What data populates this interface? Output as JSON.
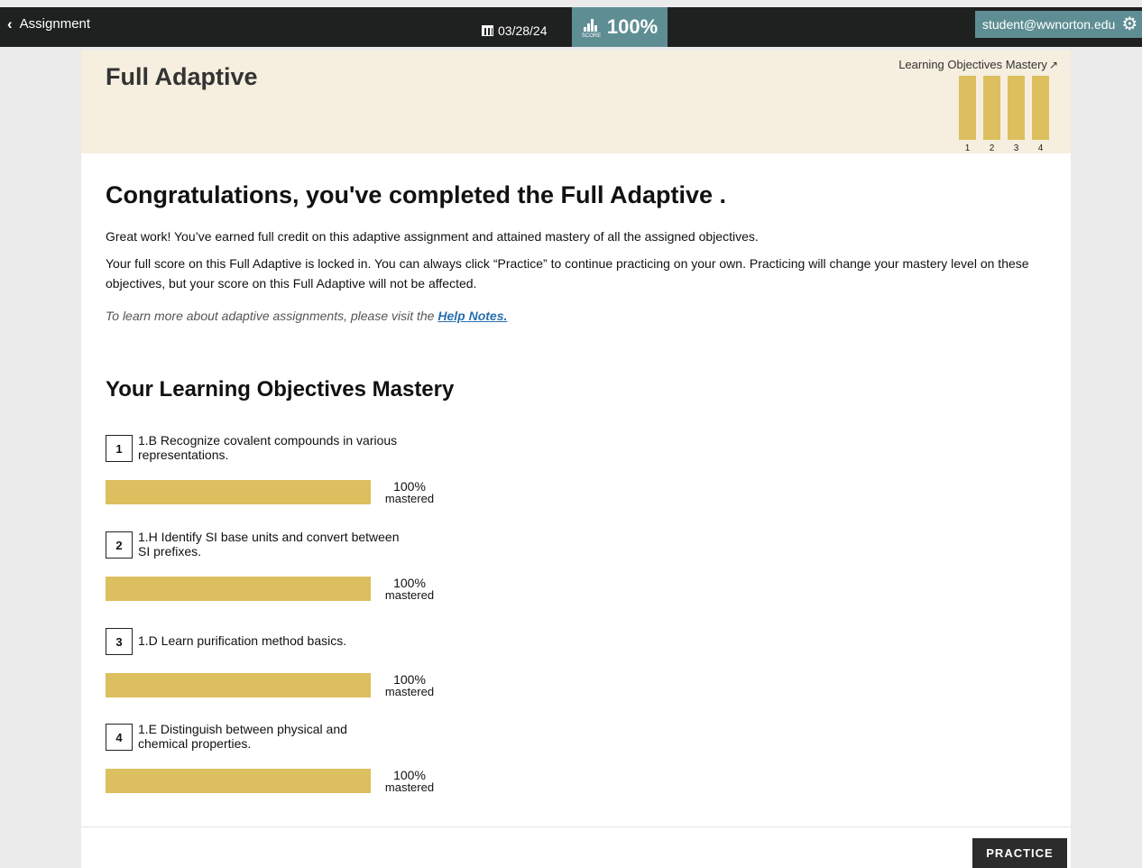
{
  "topbar": {
    "back_label": "Assignment",
    "due_date": "03/28/24",
    "score_caption": "SCORE",
    "score_value": "100%",
    "user_email": "student@wwnorton.edu",
    "accent_color": "#5e8e93"
  },
  "banner": {
    "title": "Full Adaptive",
    "mastery_title": "Learning Objectives Mastery",
    "bars": [
      {
        "label": "1",
        "level": 1.0
      },
      {
        "label": "2",
        "level": 1.0
      },
      {
        "label": "3",
        "level": 1.0
      },
      {
        "label": "4",
        "level": 1.0
      }
    ]
  },
  "main": {
    "heading": "Congratulations, you've completed the Full Adaptive .",
    "para1": "Great work! You’ve earned full credit on this adaptive assignment and attained mastery of all the assigned objectives.",
    "para2": "Your full score on this Full Adaptive is locked in. You can always click “Practice” to continue practicing on your own. Practicing will change your mastery level on these objectives, but your score on this Full Adaptive will not be affected.",
    "help_prefix": "To learn more about adaptive assignments, please visit the ",
    "help_link": "Help Notes."
  },
  "mastery": {
    "heading": "Your Learning Objectives Mastery",
    "bar_color": "#dcbf5e",
    "objectives": [
      {
        "num": "1",
        "text": "1.B Recognize covalent compounds in various representations.",
        "percent": "100%",
        "status": "mastered",
        "level": 1.0
      },
      {
        "num": "2",
        "text": "1.H Identify SI base units and convert between SI prefixes.",
        "percent": "100%",
        "status": "mastered",
        "level": 1.0
      },
      {
        "num": "3",
        "text": "1.D Learn purification method basics.",
        "percent": "100%",
        "status": "mastered",
        "level": 1.0
      },
      {
        "num": "4",
        "text": "1.E Distinguish between physical and chemical properties.",
        "percent": "100%",
        "status": "mastered",
        "level": 1.0
      }
    ]
  },
  "footer": {
    "practice_label": "PRACTICE"
  }
}
